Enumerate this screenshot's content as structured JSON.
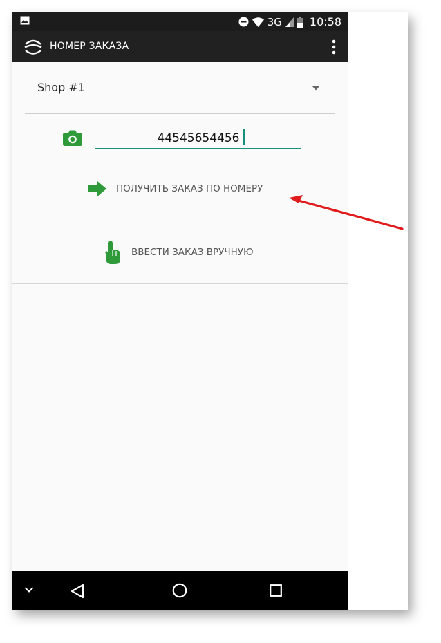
{
  "status_bar": {
    "network": "3G",
    "time": "10:58",
    "icons": [
      "image-icon",
      "do-not-disturb-icon",
      "wifi-icon",
      "signal-icon",
      "battery-icon"
    ]
  },
  "app_bar": {
    "title": "НОМЕР ЗАКАЗА",
    "logo_icon": "app-logo-icon",
    "menu_icon": "overflow-menu-icon"
  },
  "shop": {
    "selected": "Shop #1"
  },
  "order": {
    "value": "44545654456"
  },
  "actions": {
    "get_order_label": "ПОЛУЧИТЬ ЗАКАЗ ПО НОМЕРУ",
    "manual_label": "ВВЕСТИ ЗАКАЗ ВРУЧНУЮ"
  },
  "colors": {
    "accent_green": "#2e9a3a",
    "input_underline": "#188f7b",
    "annotation_red": "#e01b1b",
    "app_bar": "#212121"
  },
  "nav_bar": {
    "icons": [
      "chevron-down-icon",
      "back-icon",
      "home-icon",
      "recents-icon"
    ]
  }
}
